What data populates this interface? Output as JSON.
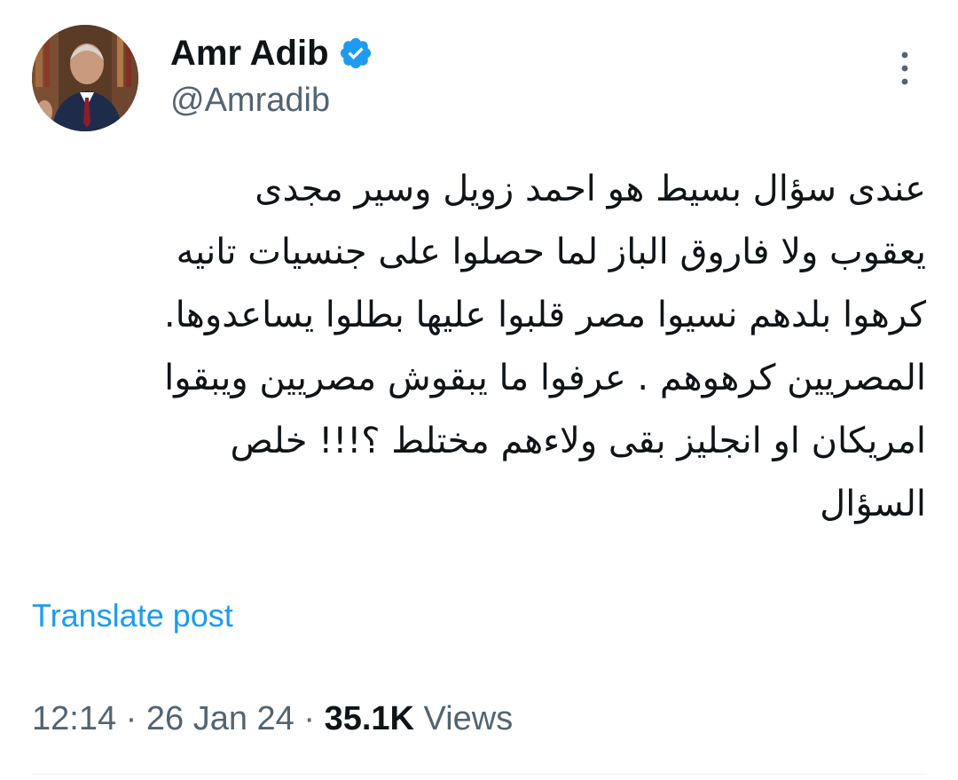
{
  "author": {
    "display_name": "Amr Adib",
    "handle": "@Amradib",
    "verified_icon": "verified-badge-icon",
    "avatar_icon": "profile-photo"
  },
  "menu": {
    "icon": "more-vertical-icon"
  },
  "tweet": {
    "lines": [
      "عندى سؤال بسيط هو احمد زويل وسير مجدى",
      "يعقوب ولا فاروق الباز لما حصلوا على جنسيات تانيه",
      "كرهوا بلدهم نسيوا مصر قلبوا عليها بطلوا يساعدوها.",
      "المصريين كرهوهم . عرفوا ما يبقوش مصريين ويبقوا",
      "امريكان او انجليز بقى ولاءهم مختلط ؟!!! خلص",
      "السؤال"
    ]
  },
  "translate_label": "Translate post",
  "meta": {
    "time": "12:14",
    "separator": " · ",
    "date": "26 Jan 24",
    "views_count": "35.1K",
    "views_label": " Views"
  },
  "colors": {
    "text": "#0f1419",
    "secondary": "#536471",
    "link": "#1d9bf0",
    "verified": "#1d9bf0"
  }
}
